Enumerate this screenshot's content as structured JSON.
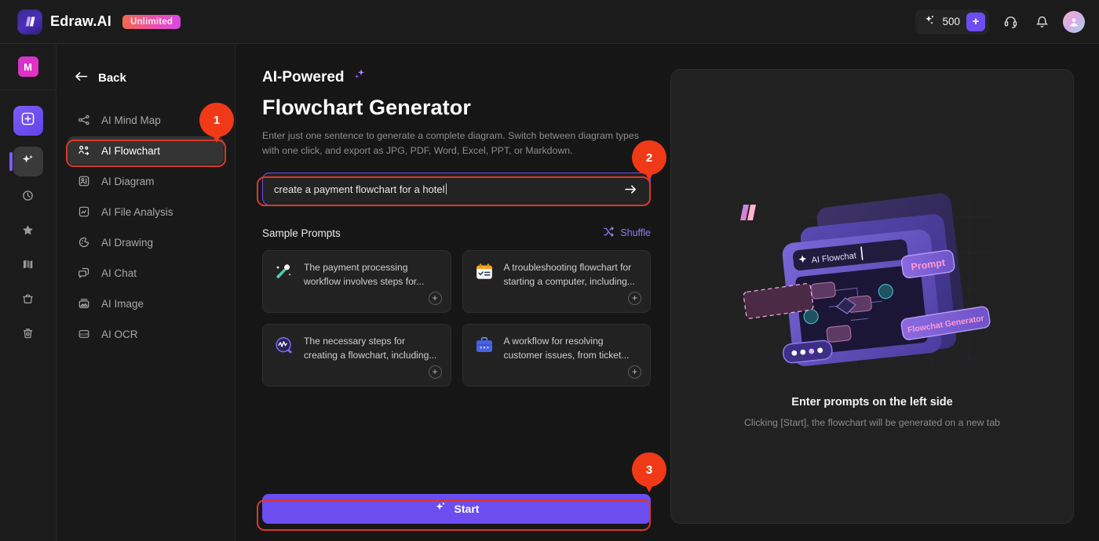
{
  "header": {
    "brand_name": "Edraw.AI",
    "plan_badge": "Unlimited",
    "credits": "500",
    "credit_add_label": "+",
    "icons": {
      "sparkle": "sparkle-icon",
      "support": "headset-icon",
      "bell": "bell-icon",
      "avatar": "user-avatar"
    }
  },
  "rail": {
    "user_initial": "M",
    "items": [
      {
        "name": "new-document",
        "icon": "plus-square-icon"
      },
      {
        "name": "ai-tools",
        "icon": "sparkle-icon"
      },
      {
        "name": "recent",
        "icon": "clock-icon"
      },
      {
        "name": "favorites",
        "icon": "star-icon"
      },
      {
        "name": "templates",
        "icon": "shapes-icon"
      },
      {
        "name": "files",
        "icon": "folder-icon"
      },
      {
        "name": "trash",
        "icon": "trash-icon"
      }
    ]
  },
  "sidebar": {
    "back_label": "Back",
    "items": [
      {
        "label": "AI Mind Map",
        "icon": "mindmap-icon",
        "selected": false
      },
      {
        "label": "AI Flowchart",
        "icon": "flowchart-icon",
        "selected": true
      },
      {
        "label": "AI Diagram",
        "icon": "diagram-icon",
        "selected": false
      },
      {
        "label": "AI File Analysis",
        "icon": "file-analysis-icon",
        "selected": false
      },
      {
        "label": "AI Drawing",
        "icon": "drawing-icon",
        "selected": false
      },
      {
        "label": "AI Chat",
        "icon": "chat-icon",
        "selected": false
      },
      {
        "label": "AI Image",
        "icon": "image-icon",
        "selected": false
      },
      {
        "label": "AI OCR",
        "icon": "ocr-icon",
        "selected": false
      }
    ]
  },
  "main": {
    "eyebrow": "AI-Powered",
    "title": "Flowchart Generator",
    "subtitle": "Enter just one sentence to generate a complete diagram. Switch between diagram types with one click, and export as JPG, PDF, Word, Excel, PPT, or Markdown.",
    "prompt": {
      "value": "create a payment flowchart for a hotel",
      "placeholder": "create a payment flowchart for a hotel",
      "send_icon": "arrow-right-icon"
    },
    "sample_prompts_title": "Sample Prompts",
    "shuffle_label": "Shuffle",
    "cards": [
      {
        "text": "The payment processing workflow involves steps for...",
        "icon": "magic-wand-icon",
        "add_label": "+"
      },
      {
        "text": "A troubleshooting flowchart for starting a computer, including...",
        "icon": "checklist-icon",
        "add_label": "+"
      },
      {
        "text": "The necessary steps for creating a flowchart, including...",
        "icon": "analytics-icon",
        "add_label": "+"
      },
      {
        "text": "A workflow for resolving customer issues, from ticket...",
        "icon": "briefcase-icon",
        "add_label": "+"
      }
    ],
    "start_label": "Start"
  },
  "preview": {
    "heading": "Enter prompts on the left side",
    "description": "Clicking [Start], the flowchart will be generated on a new tab",
    "illustration_labels": {
      "input": "AI Flowchat",
      "tag_prompt": "Prompt",
      "tag_generator": "Flowchat Generator"
    }
  },
  "annotations": [
    {
      "number": "1",
      "target": "sidebar-item-ai-flowchart"
    },
    {
      "number": "2",
      "target": "prompt-input"
    },
    {
      "number": "3",
      "target": "start-button"
    }
  ],
  "colors": {
    "accent_purple": "#6c4df0",
    "annotation_red": "#f03a17",
    "highlight_border": "#d8382a",
    "background": "#161616"
  }
}
